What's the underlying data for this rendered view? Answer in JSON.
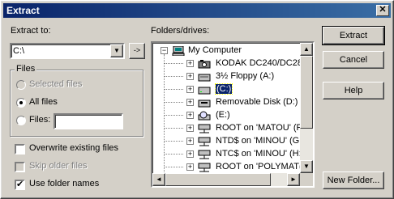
{
  "window": {
    "title": "Extract"
  },
  "extract_to": {
    "label": "Extract to:",
    "value": "C:\\"
  },
  "folders_label": "Folders/drives:",
  "files_group": {
    "legend": "Files",
    "options": [
      {
        "label": "Selected files",
        "checked": false,
        "enabled": false
      },
      {
        "label": "All files",
        "checked": true,
        "enabled": true
      },
      {
        "label": "Files:",
        "checked": false,
        "enabled": true
      }
    ],
    "files_input_value": ""
  },
  "checkboxes": [
    {
      "label": "Overwrite existing files",
      "checked": false,
      "enabled": true
    },
    {
      "label": "Skip older files",
      "checked": false,
      "enabled": false
    },
    {
      "label": "Use folder names",
      "checked": true,
      "enabled": true
    }
  ],
  "buttons": {
    "extract": "Extract",
    "cancel": "Cancel",
    "help": "Help",
    "new_folder": "New Folder..."
  },
  "tree": {
    "root": "My Computer",
    "items": [
      {
        "label": "KODAK DC240/DC28",
        "icon": "camera-icon"
      },
      {
        "label": "3½ Floppy (A:)",
        "icon": "floppy-icon"
      },
      {
        "label": "(C:)",
        "icon": "hard-drive-icon",
        "selected": true
      },
      {
        "label": "Removable Disk (D:)",
        "icon": "removable-disk-icon"
      },
      {
        "label": "(E:)",
        "icon": "cd-drive-icon"
      },
      {
        "label": "ROOT on 'MATOU' (F",
        "icon": "network-drive-icon"
      },
      {
        "label": "NTD$ on 'MINOU' (G:",
        "icon": "network-drive-icon"
      },
      {
        "label": "NTC$ on 'MINOU' (H:",
        "icon": "network-drive-icon"
      },
      {
        "label": "ROOT on 'POLYMAT(",
        "icon": "network-drive-icon"
      }
    ]
  }
}
